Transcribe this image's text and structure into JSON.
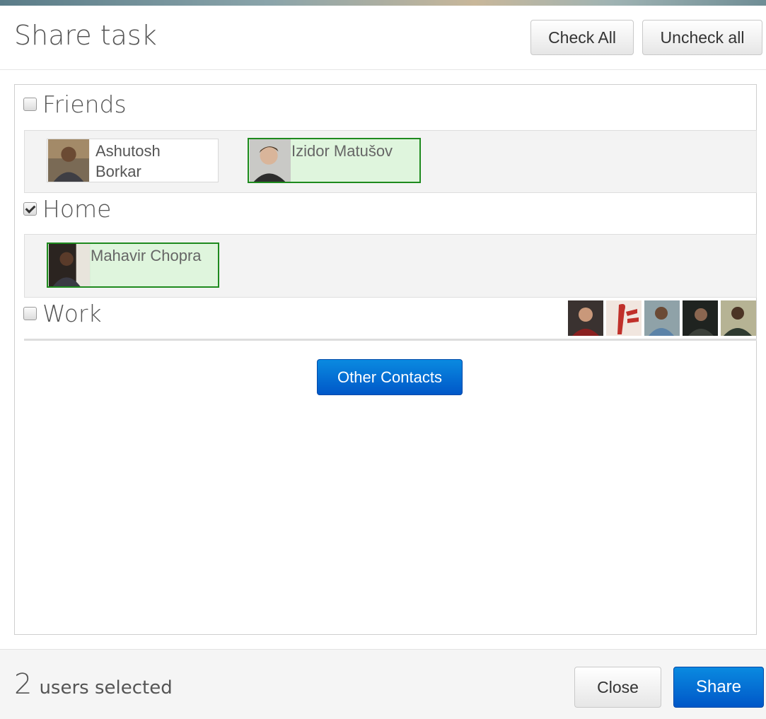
{
  "dialog": {
    "title": "Share task",
    "check_all_label": "Check All",
    "uncheck_all_label": "Uncheck all"
  },
  "groups": [
    {
      "label": "Friends",
      "checked": false,
      "members": [
        {
          "name_line1": "Ashutosh",
          "name_line2": "Borkar",
          "selected": false
        },
        {
          "name": "Izidor Matušov",
          "selected": true
        }
      ]
    },
    {
      "label": "Home",
      "checked": true,
      "members": [
        {
          "name": "Mahavir Chopra",
          "selected": true
        }
      ]
    },
    {
      "label": "Work",
      "checked": false,
      "collapsed_avatar_count": 5
    }
  ],
  "other_contacts_label": "Other Contacts",
  "footer": {
    "selected_count": "2",
    "selected_text": "users selected",
    "close_label": "Close",
    "share_label": "Share"
  },
  "colors": {
    "primary": "#0a6fd8",
    "selected_bg": "#dff5dd",
    "selected_border": "#1e8a1e"
  }
}
